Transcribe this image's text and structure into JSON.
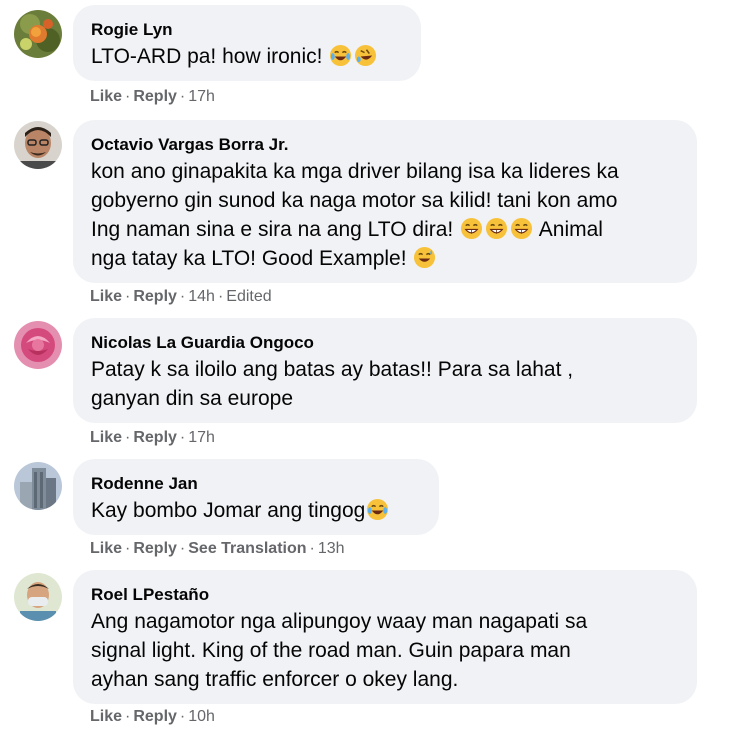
{
  "comments": [
    {
      "author": "Rogie Lyn",
      "text": "LTO-ARD pa! how ironic! ",
      "emojis": [
        "face-with-tears-of-joy-emoji",
        "rolling-on-floor-laughing-emoji"
      ],
      "like": "Like",
      "reply": "Reply",
      "time": "17h"
    },
    {
      "author": "Octavio Vargas Borra Jr.",
      "text_lines": [
        "kon ano ginapakita ka mga driver bilang isa ka lideres ka",
        "gobyerno gin sunod ka naga motor sa kilid! tani kon amo",
        "Ing naman sina e sira na ang LTO dira! ",
        " Animal",
        "nga tatay ka LTO! Good Example! "
      ],
      "emojis": [
        "grinning-face-with-sweat-emoji"
      ],
      "like": "Like",
      "reply": "Reply",
      "time": "14h",
      "edited": "Edited"
    },
    {
      "author": "Nicolas La Guardia Ongoco",
      "text_lines": [
        "Patay k sa iloilo ang batas ay batas!! Para sa lahat ,",
        "ganyan din sa europe"
      ],
      "like": "Like",
      "reply": "Reply",
      "time": "17h"
    },
    {
      "author": "Rodenne Jan",
      "text": "Kay bombo Jomar ang tingog",
      "emojis": [
        "face-with-tears-of-joy-emoji"
      ],
      "like": "Like",
      "reply": "Reply",
      "see_translation": "See Translation",
      "time": "13h"
    },
    {
      "author": "Roel LPestaño",
      "text_lines": [
        "Ang nagamotor nga alipungoy waay man nagapati sa",
        "signal light. King of the road man. Guin papara man",
        "ayhan sang traffic enforcer o okey lang."
      ],
      "like": "Like",
      "reply": "Reply",
      "time": "10h"
    }
  ],
  "separator": "·",
  "colors": {
    "bubble": "#f0f2f5",
    "meta": "#65676b",
    "text": "#050505"
  }
}
